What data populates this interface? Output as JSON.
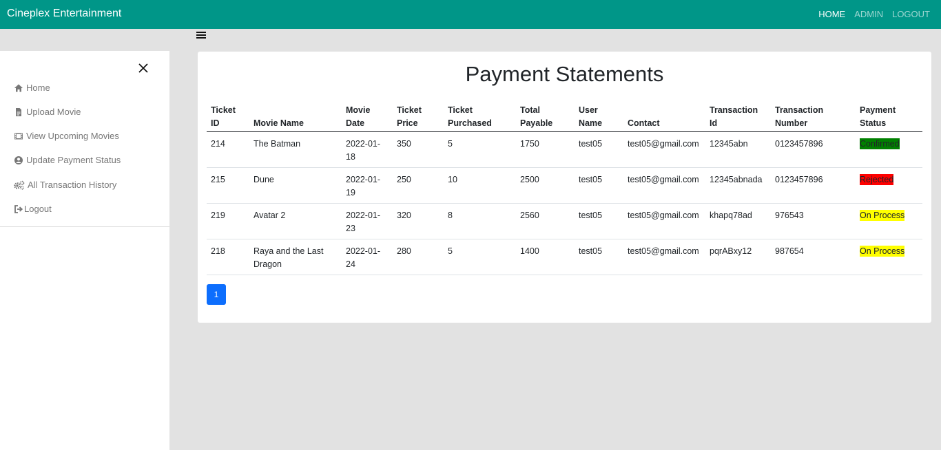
{
  "navbar": {
    "brand": "Cineplex Entertainment",
    "links": [
      {
        "label": "HOME",
        "active": true
      },
      {
        "label": "ADMIN",
        "active": false
      },
      {
        "label": "LOGOUT",
        "active": false
      }
    ],
    "color": "#009688"
  },
  "sidebar": {
    "items": [
      {
        "label": "Home",
        "icon": "home-icon"
      },
      {
        "label": "Upload Movie",
        "icon": "file-icon"
      },
      {
        "label": "View Upcoming Movies",
        "icon": "film-icon"
      },
      {
        "label": "Update Payment Status",
        "icon": "user-circle-icon"
      },
      {
        "label": "All Transaction History",
        "icon": "gears-icon"
      },
      {
        "label": "Logout",
        "icon": "sign-out-icon"
      }
    ]
  },
  "main": {
    "title": "Payment Statements",
    "columns": [
      "Ticket ID",
      "Movie Name",
      "Movie Date",
      "Ticket Price",
      "Ticket Purchased",
      "Total Payable",
      "User Name",
      "Contact",
      "Transaction Id",
      "Transaction Number",
      "Payment Status"
    ],
    "rows": [
      {
        "ticket_id": "214",
        "movie": "The Batman",
        "date": "2022-01-18",
        "price": "350",
        "purchased": "5",
        "total": "1750",
        "user": "test05",
        "contact": "test05@gmail.com",
        "txn_id": "12345abn",
        "txn_number": "0123457896",
        "status": "Confirmed"
      },
      {
        "ticket_id": "215",
        "movie": "Dune",
        "date": "2022-01-19",
        "price": "250",
        "purchased": "10",
        "total": "2500",
        "user": "test05",
        "contact": "test05@gmail.com",
        "txn_id": "12345abnada",
        "txn_number": "0123457896",
        "status": "Rejected"
      },
      {
        "ticket_id": "219",
        "movie": "Avatar 2",
        "date": "2022-01-23",
        "price": "320",
        "purchased": "8",
        "total": "2560",
        "user": "test05",
        "contact": "test05@gmail.com",
        "txn_id": "khapq78ad",
        "txn_number": "976543",
        "status": "On Process"
      },
      {
        "ticket_id": "218",
        "movie": "Raya and the Last Dragon",
        "date": "2022-01-24",
        "price": "280",
        "purchased": "5",
        "total": "1400",
        "user": "test05",
        "contact": "test05@gmail.com",
        "txn_id": "pqrABxy12",
        "txn_number": "987654",
        "status": "On Process"
      }
    ],
    "status_colors": {
      "Confirmed": "#008000",
      "Rejected": "#ff0000",
      "On Process": "#ffff00"
    },
    "pagination": {
      "current": "1"
    }
  }
}
